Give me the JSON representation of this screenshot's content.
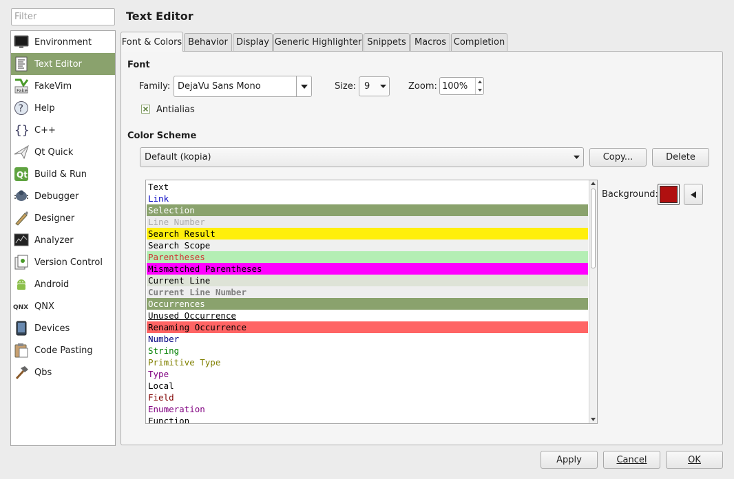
{
  "filter": {
    "placeholder": "Filter"
  },
  "sidebar": {
    "items": [
      {
        "label": "Environment",
        "icon": "monitor-icon"
      },
      {
        "label": "Text Editor",
        "icon": "text-editor-icon"
      },
      {
        "label": "FakeVim",
        "icon": "fakevim-icon"
      },
      {
        "label": "Help",
        "icon": "help-icon"
      },
      {
        "label": "C++",
        "icon": "braces-icon"
      },
      {
        "label": "Qt Quick",
        "icon": "paper-plane-icon"
      },
      {
        "label": "Build & Run",
        "icon": "build-run-icon"
      },
      {
        "label": "Debugger",
        "icon": "debugger-icon"
      },
      {
        "label": "Designer",
        "icon": "designer-icon"
      },
      {
        "label": "Analyzer",
        "icon": "analyzer-icon"
      },
      {
        "label": "Version Control",
        "icon": "version-control-icon"
      },
      {
        "label": "Android",
        "icon": "android-icon"
      },
      {
        "label": "QNX",
        "icon": "qnx-icon"
      },
      {
        "label": "Devices",
        "icon": "devices-icon"
      },
      {
        "label": "Code Pasting",
        "icon": "code-pasting-icon"
      },
      {
        "label": "Qbs",
        "icon": "hammer-icon"
      }
    ]
  },
  "header": {
    "title": "Text Editor"
  },
  "tabs": [
    {
      "label": "Font & Colors"
    },
    {
      "label": "Behavior"
    },
    {
      "label": "Display"
    },
    {
      "label": "Generic Highlighter"
    },
    {
      "label": "Snippets"
    },
    {
      "label": "Macros"
    },
    {
      "label": "Completion"
    }
  ],
  "font": {
    "section_title": "Font",
    "family_label": "Family:",
    "family_value": "DejaVu Sans Mono",
    "size_label": "Size:",
    "size_value": "9",
    "zoom_label": "Zoom:",
    "zoom_value": "100%",
    "antialias_label": "Antialias"
  },
  "color_scheme": {
    "section_title": "Color Scheme",
    "selected": "Default (kopia)",
    "copy_button": "Copy...",
    "delete_button": "Delete",
    "background_label": "Background:",
    "background_color": "#b01010",
    "items": [
      {
        "label": "Text",
        "fg": "#000000",
        "bg": ""
      },
      {
        "label": "Link",
        "fg": "#0000c0",
        "bg": ""
      },
      {
        "label": "Selection",
        "fg": "#ffffff",
        "bg": "#8aa26d"
      },
      {
        "label": "Line Number",
        "fg": "#aaaaaa",
        "bg": "#ececec"
      },
      {
        "label": "Search Result",
        "fg": "#000000",
        "bg": "#ffef0b"
      },
      {
        "label": "Search Scope",
        "fg": "#000000",
        "bg": "#eff0ef"
      },
      {
        "label": "Parentheses",
        "fg": "#d03030",
        "bg": "#b4eeb4"
      },
      {
        "label": "Mismatched Parentheses",
        "fg": "#000000",
        "bg": "#ff00ff"
      },
      {
        "label": "Current Line",
        "fg": "#000000",
        "bg": "#dee3d7"
      },
      {
        "label": "Current Line Number",
        "fg": "#808080",
        "bg": "#eeeeee",
        "bold": true
      },
      {
        "label": "Occurrences",
        "fg": "#ffffff",
        "bg": "#8aa26d"
      },
      {
        "label": "Unused Occurrence",
        "fg": "#000000",
        "bg": "",
        "underline": true
      },
      {
        "label": "Renaming Occurrence",
        "fg": "#000000",
        "bg": "#ff6464"
      },
      {
        "label": "Number",
        "fg": "#000080",
        "bg": ""
      },
      {
        "label": "String",
        "fg": "#008000",
        "bg": ""
      },
      {
        "label": "Primitive Type",
        "fg": "#808000",
        "bg": ""
      },
      {
        "label": "Type",
        "fg": "#800080",
        "bg": ""
      },
      {
        "label": "Local",
        "fg": "#000000",
        "bg": ""
      },
      {
        "label": "Field",
        "fg": "#800000",
        "bg": ""
      },
      {
        "label": "Enumeration",
        "fg": "#800080",
        "bg": ""
      },
      {
        "label": "Function",
        "fg": "#000000",
        "bg": ""
      }
    ]
  },
  "footer": {
    "apply": "Apply",
    "cancel": "Cancel",
    "ok": "OK"
  }
}
